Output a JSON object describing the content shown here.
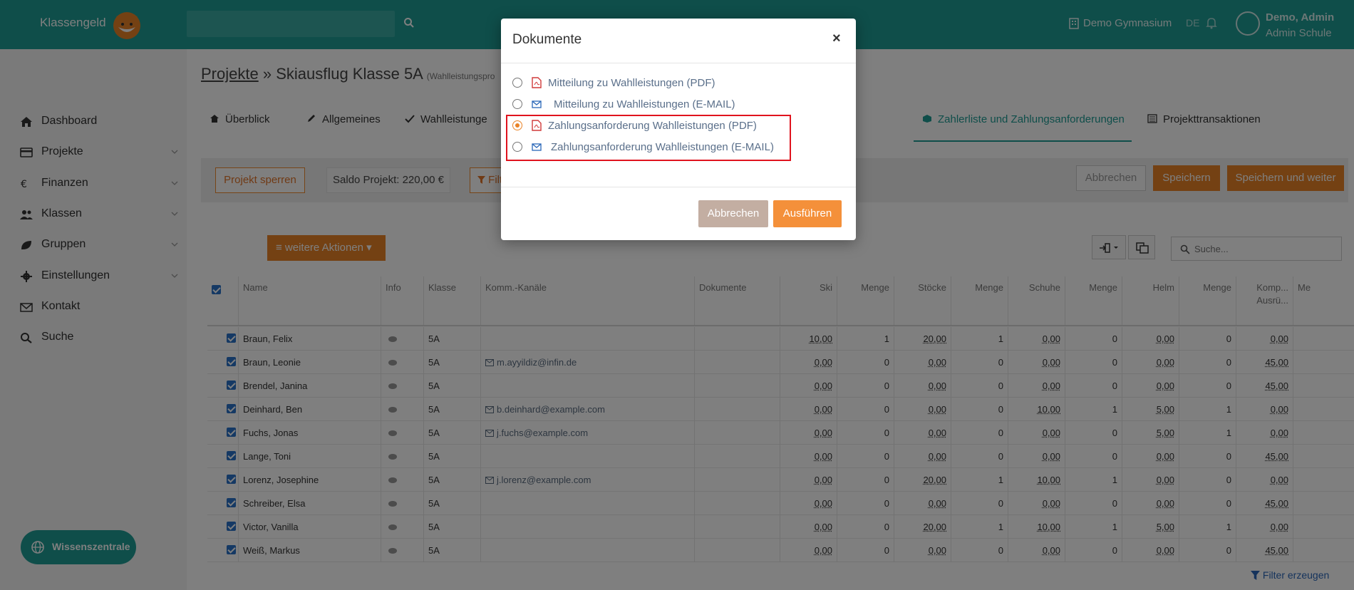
{
  "header": {
    "brand": "Klassengeld",
    "school": "Demo Gymnasium",
    "lang": "DE",
    "user_name": "Demo, Admin",
    "user_role": "Admin Schule"
  },
  "sidebar": {
    "items": [
      {
        "label": "Dashboard"
      },
      {
        "label": "Projekte"
      },
      {
        "label": "Finanzen"
      },
      {
        "label": "Klassen"
      },
      {
        "label": "Gruppen"
      },
      {
        "label": "Einstellungen"
      },
      {
        "label": "Kontakt"
      },
      {
        "label": "Suche"
      }
    ],
    "help_label": "Wissenszentrale"
  },
  "main": {
    "breadcrumb_link": "Projekte",
    "breadcrumb_sep": " » ",
    "breadcrumb_current": "Skiausflug Klasse 5A",
    "breadcrumb_type": "(Wahlleistungspro",
    "tabs": [
      {
        "label": "Überblick"
      },
      {
        "label": "Allgemeines"
      },
      {
        "label": "Wahlleistunge"
      },
      {
        "label": "Zahlerliste und Zahlungsanforderungen"
      },
      {
        "label": "Projekttransaktionen"
      }
    ],
    "lock_label": "Projekt sperren",
    "saldo_label": "Saldo Projekt: 220,00 €",
    "filter_label": "Filt",
    "cancel_label": "Abbrechen",
    "save_label": "Speichern",
    "save_next_label": "Speichern und weiter",
    "more_actions_label": "≡ weitere Aktionen ▾",
    "search_placeholder": "Suche...",
    "filter_create_label": "Filter erzeugen"
  },
  "table": {
    "columns": [
      "Name",
      "Info",
      "Klasse",
      "Komm.-Kanäle",
      "Dokumente",
      "Ski",
      "Menge",
      "Stöcke",
      "Menge",
      "Schuhe",
      "Menge",
      "Helm",
      "Menge",
      "Komp...",
      "Me"
    ],
    "col_extra": "Ausrü...",
    "rows": [
      {
        "name": "Braun, Felix",
        "klasse": "5A",
        "mail": "",
        "ski": "10,00",
        "m1": "1",
        "stoecke": "20,00",
        "m2": "1",
        "schuhe": "0,00",
        "m3": "0",
        "helm": "0,00",
        "m4": "0",
        "komp": "0,00"
      },
      {
        "name": "Braun, Leonie",
        "klasse": "5A",
        "mail": "m.ayyildiz@infin.de",
        "ski": "0,00",
        "m1": "0",
        "stoecke": "0,00",
        "m2": "0",
        "schuhe": "0,00",
        "m3": "0",
        "helm": "0,00",
        "m4": "0",
        "komp": "45,00"
      },
      {
        "name": "Brendel, Janina",
        "klasse": "5A",
        "mail": "",
        "ski": "0,00",
        "m1": "0",
        "stoecke": "0,00",
        "m2": "0",
        "schuhe": "0,00",
        "m3": "0",
        "helm": "0,00",
        "m4": "0",
        "komp": "45,00"
      },
      {
        "name": "Deinhard, Ben",
        "klasse": "5A",
        "mail": "b.deinhard@example.com",
        "ski": "0,00",
        "m1": "0",
        "stoecke": "0,00",
        "m2": "0",
        "schuhe": "10,00",
        "m3": "1",
        "helm": "5,00",
        "m4": "1",
        "komp": "0,00"
      },
      {
        "name": "Fuchs, Jonas",
        "klasse": "5A",
        "mail": "j.fuchs@example.com",
        "ski": "0,00",
        "m1": "0",
        "stoecke": "0,00",
        "m2": "0",
        "schuhe": "0,00",
        "m3": "0",
        "helm": "5,00",
        "m4": "1",
        "komp": "0,00"
      },
      {
        "name": "Lange, Toni",
        "klasse": "5A",
        "mail": "",
        "ski": "0,00",
        "m1": "0",
        "stoecke": "0,00",
        "m2": "0",
        "schuhe": "0,00",
        "m3": "0",
        "helm": "0,00",
        "m4": "0",
        "komp": "45,00"
      },
      {
        "name": "Lorenz, Josephine",
        "klasse": "5A",
        "mail": "j.lorenz@example.com",
        "ski": "0,00",
        "m1": "0",
        "stoecke": "20,00",
        "m2": "1",
        "schuhe": "10,00",
        "m3": "1",
        "helm": "0,00",
        "m4": "0",
        "komp": "0,00"
      },
      {
        "name": "Schreiber, Elsa",
        "klasse": "5A",
        "mail": "",
        "ski": "0,00",
        "m1": "0",
        "stoecke": "0,00",
        "m2": "0",
        "schuhe": "0,00",
        "m3": "0",
        "helm": "0,00",
        "m4": "0",
        "komp": "45,00"
      },
      {
        "name": "Victor, Vanilla",
        "klasse": "5A",
        "mail": "",
        "ski": "0,00",
        "m1": "0",
        "stoecke": "20,00",
        "m2": "1",
        "schuhe": "10,00",
        "m3": "1",
        "helm": "5,00",
        "m4": "1",
        "komp": "0,00"
      },
      {
        "name": "Weiß, Markus",
        "klasse": "5A",
        "mail": "",
        "ski": "0,00",
        "m1": "0",
        "stoecke": "0,00",
        "m2": "0",
        "schuhe": "0,00",
        "m3": "0",
        "helm": "0,00",
        "m4": "0",
        "komp": "45,00"
      }
    ]
  },
  "modal": {
    "title": "Dokumente",
    "close": "×",
    "options": [
      {
        "label": "Mitteilung zu Wahlleistungen (PDF)",
        "icon": "pdf-icon",
        "checked": false
      },
      {
        "label": "Mitteilung zu Wahlleistungen (E-MAIL)",
        "icon": "envelope-icon",
        "checked": false
      },
      {
        "label": "Zahlungsanforderung Wahlleistungen (PDF)",
        "icon": "pdf-icon",
        "checked": true
      },
      {
        "label": "Zahlungsanforderung Wahlleistungen (E-MAIL)",
        "icon": "envelope-icon",
        "checked": false
      }
    ],
    "cancel_label": "Abbrechen",
    "run_label": "Ausführen"
  },
  "colors": {
    "brand": "#1f9c95",
    "accent": "#e98327",
    "highlight": "#e0131e"
  }
}
